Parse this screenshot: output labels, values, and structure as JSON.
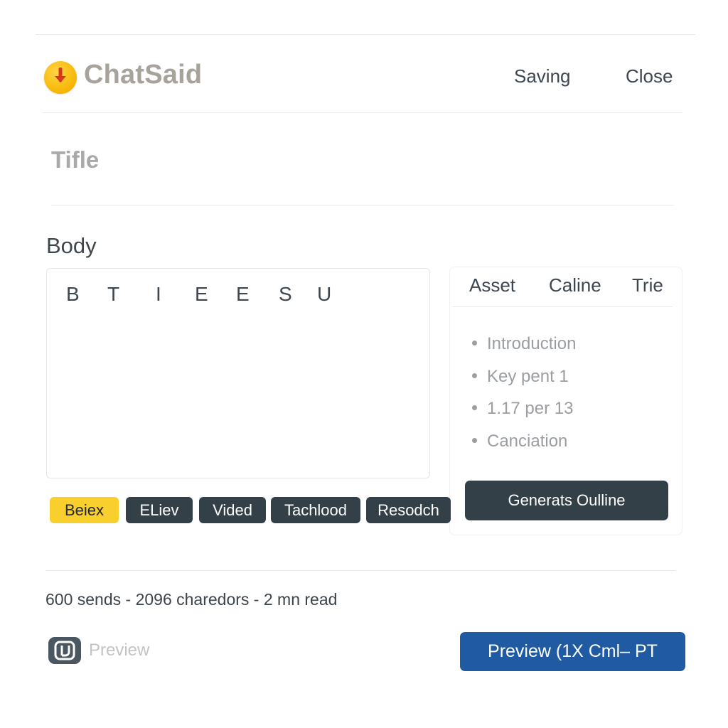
{
  "app": {
    "name": "ChatSaid",
    "logo_icon": "download-arrow-icon",
    "logo_color": "#f7b500"
  },
  "header": {
    "saving_label": "Saving",
    "close_label": "Close"
  },
  "title_field": {
    "placeholder": "Tifle"
  },
  "body_section": {
    "label": "Body",
    "toolbar": [
      "B",
      "T",
      "I",
      "E",
      "E",
      "S",
      "U"
    ]
  },
  "side_panel": {
    "tabs": [
      "Asset",
      "Caline",
      "Trie"
    ],
    "outline": [
      "Introduction",
      "Key pent 1",
      "1.17 per 13",
      "Canciation"
    ],
    "generate_label": "Generats Oulline"
  },
  "chips": [
    {
      "label": "Beiex",
      "active": true
    },
    {
      "label": "ELiev",
      "active": false
    },
    {
      "label": "Vided",
      "active": false
    },
    {
      "label": "Tachlood",
      "active": false
    },
    {
      "label": "Resodch",
      "active": false
    }
  ],
  "footer": {
    "stats": "600 sends - 2096 charedors - 2 mn read",
    "preview_link": "Preview",
    "preview_button": "Preview (1X Cml– PT"
  },
  "colors": {
    "accent_yellow": "#f9cf2d",
    "dark_button": "#334048",
    "primary_blue": "#1f5aa3"
  }
}
